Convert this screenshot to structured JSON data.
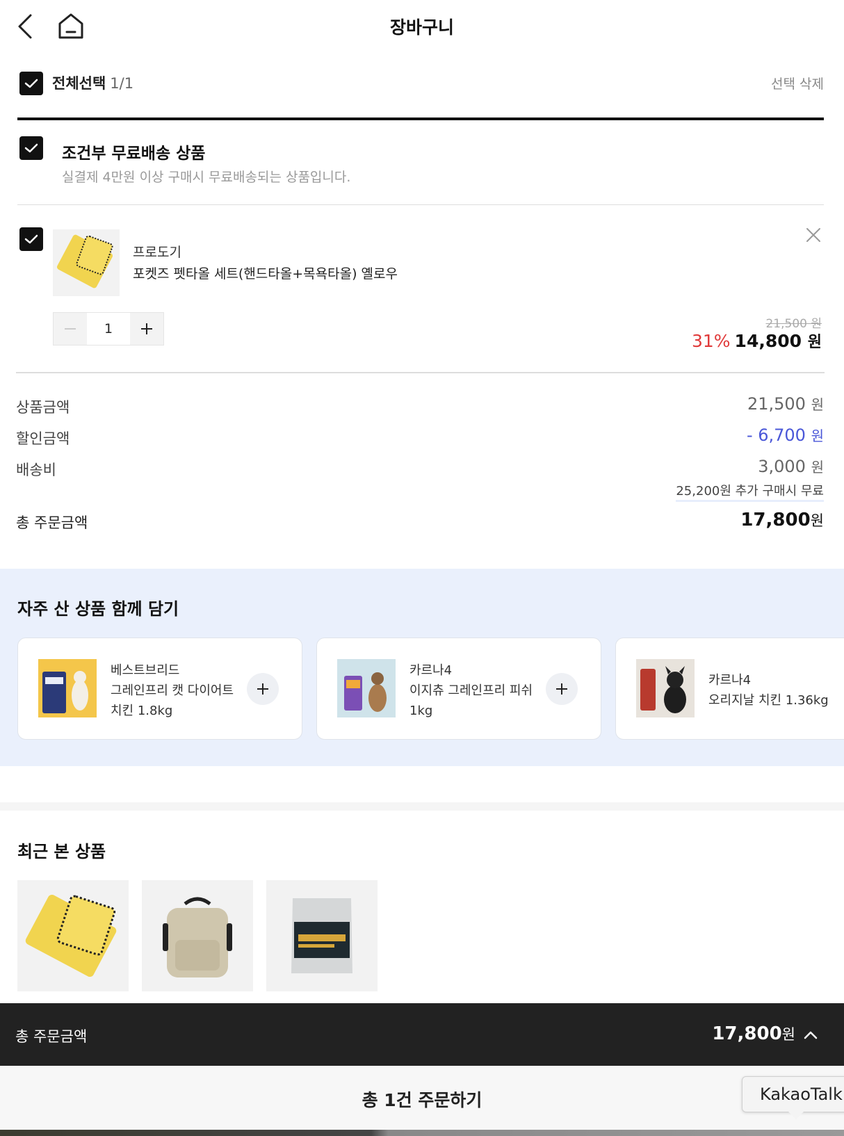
{
  "header": {
    "title": "장바구니"
  },
  "select_all": {
    "label": "전체선택",
    "count": "1/1",
    "delete_selected": "선택 삭제"
  },
  "shipping_group": {
    "title": "조건부 무료배송 상품",
    "description": "실결제 4만원 이상 구매시 무료배송되는 상품입니다."
  },
  "cart_item": {
    "brand": "프로도기",
    "name": "포켓즈 펫타올 세트(핸드타올+목욕타올) 옐로우",
    "quantity": "1",
    "original_price": "21,500 원",
    "discount_rate": "31%",
    "sale_price": "14,800",
    "sale_currency": "원",
    "checked": true
  },
  "summary": {
    "product_amount_label": "상품금액",
    "product_amount": "21,500",
    "discount_label": "할인금액",
    "discount_amount": "- 6,700",
    "shipping_label": "배송비",
    "shipping_amount": "3,000",
    "currency": "원",
    "free_shipping_note": "25,200원 추가 구매시 무료",
    "total_label": "총 주문금액",
    "total_amount": "17,800"
  },
  "recommend": {
    "title": "자주 산 상품 함께 담기",
    "items": [
      {
        "brand": "베스트브리드",
        "name": "그레인프리 캣 다이어트 치킨 1.8kg"
      },
      {
        "brand": "카르나4",
        "name": "이지츄 그레인프리 피쉬 1kg"
      },
      {
        "brand": "카르나4",
        "name": "오리지날 치킨 1.36kg"
      }
    ]
  },
  "recent": {
    "title": "최근 본 상품",
    "items": [
      "towel",
      "backpack",
      "dog-food-bag"
    ]
  },
  "total_bar": {
    "label": "총 주문금액",
    "amount": "17,800",
    "currency": "원"
  },
  "order_button": {
    "label": "총 1건 주문하기"
  },
  "kakao_tooltip": {
    "label": "KakaoTalk"
  },
  "colors": {
    "discount_rate": "#e03a3a",
    "discount_amount": "#4a57d8",
    "checkbox": "#111111",
    "recommend_bg": "#eaf0fc",
    "total_bar": "#222222"
  }
}
